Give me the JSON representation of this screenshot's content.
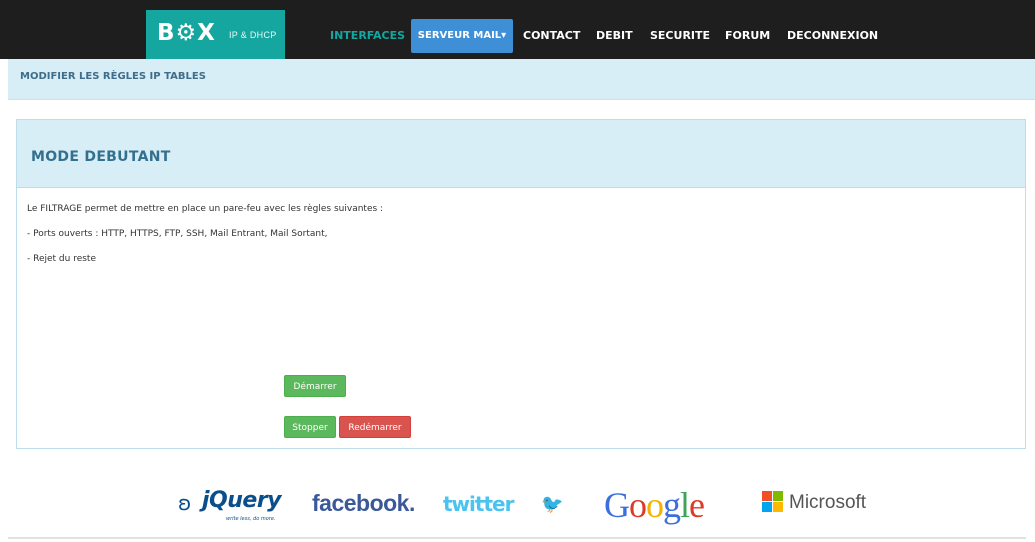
{
  "brand": {
    "logo": "B⚙X",
    "subtitle": "IP & DHCP"
  },
  "nav": {
    "interfaces": "INTERFACES",
    "serveur_mail": "SERVEUR MAIL",
    "contact": "CONTACT",
    "debit": "DEBIT",
    "securite": "SECURITE",
    "forum": "FORUM",
    "deconnexion": "DECONNEXION"
  },
  "breadcrumb": {
    "title": "MODIFIER LES RÈGLES IP TABLES"
  },
  "panel": {
    "title": "MODE DEBUTANT",
    "lines": [
      "Le FILTRAGE permet de mettre en place un pare-feu avec les règles suivantes :",
      "- Ports ouverts : HTTP, HTTPS, FTP, SSH, Mail Entrant, Mail Sortant,",
      "- Rejet du reste"
    ]
  },
  "buttons": {
    "start": "Démarrer",
    "stop": "Stopper",
    "restart": "Redémarrer"
  },
  "partners": {
    "jquery": "jQuery",
    "jquery_tagline": "write less, do more.",
    "facebook": "facebook.",
    "twitter": "twitter",
    "google": [
      "G",
      "o",
      "o",
      "g",
      "l",
      "e"
    ],
    "microsoft": "Microsoft"
  },
  "colors": {
    "accent": "#15a69f",
    "nav_active_bg": "#3e8fd6",
    "success": "#5cb85c",
    "danger": "#d9534f",
    "panel_head_bg": "#d8eef6"
  }
}
